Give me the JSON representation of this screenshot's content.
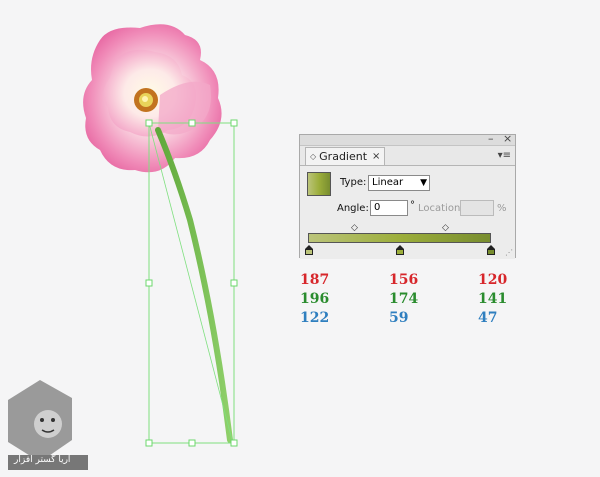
{
  "panel": {
    "title": "Gradient",
    "tab_diamond": "◇",
    "tab_close": "×",
    "collapse_symbol": "–",
    "close_symbol": "×",
    "menu_symbol": "▾≡",
    "type_label": "Type:",
    "type_value": "Linear",
    "angle_label": "Angle:",
    "angle_value": "0",
    "angle_unit": "°",
    "location_label": "Location:",
    "location_value": "",
    "location_unit": "%"
  },
  "gradient": {
    "start_color": "#bbc47a",
    "mid_color": "#9cae3b",
    "end_color": "#788d2f",
    "midpoint_symbol": "◇"
  },
  "rgb_values": {
    "stop1": {
      "r": "187",
      "g": "196",
      "b": "122"
    },
    "stop2": {
      "r": "156",
      "g": "174",
      "b": "59"
    },
    "stop3": {
      "r": "120",
      "g": "141",
      "b": "47"
    }
  },
  "logo": {
    "text": "آریا گستر افزار"
  }
}
